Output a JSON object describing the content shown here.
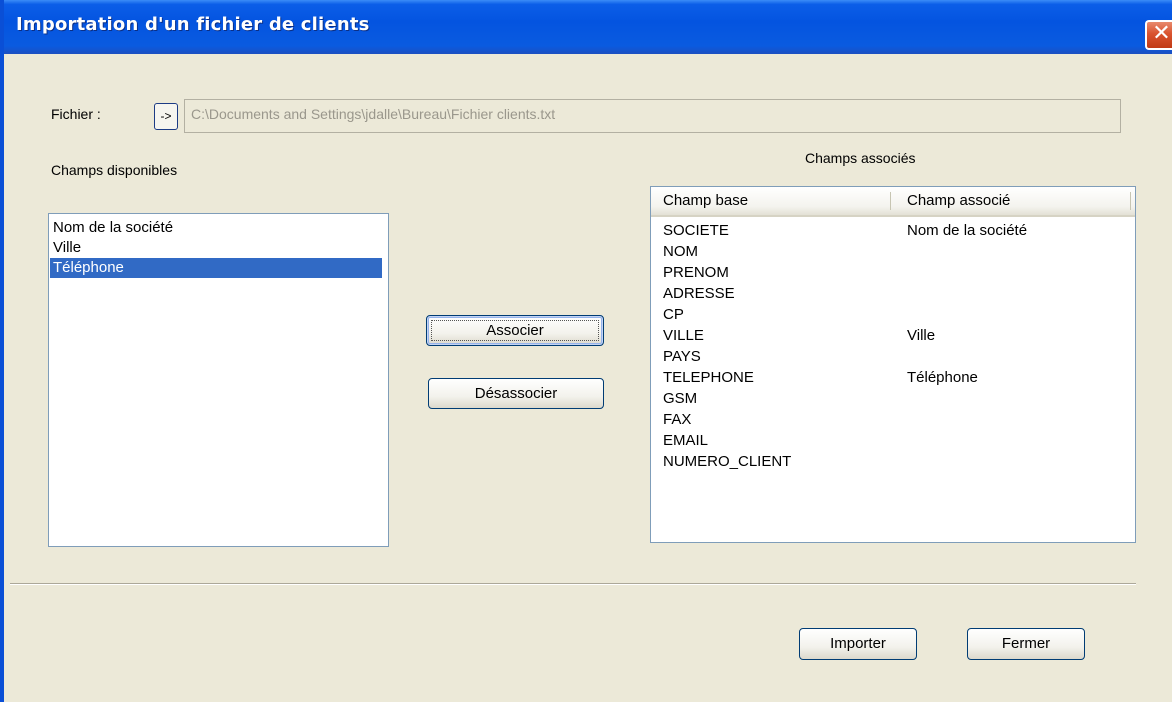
{
  "window": {
    "title": "Importation d'un fichier de clients",
    "close_glyph": "✕"
  },
  "file": {
    "label": "Fichier :",
    "browse_label": "->",
    "path": "C:\\Documents and Settings\\jdalle\\Bureau\\Fichier clients.txt"
  },
  "available": {
    "label": "Champs disponibles",
    "items": [
      "Nom de la société",
      "Ville",
      "Téléphone"
    ],
    "selected_index": 2
  },
  "actions": {
    "associate_label": "Associer",
    "dissociate_label": "Désassocier"
  },
  "associated": {
    "label": "Champs associés",
    "columns": [
      "Champ base",
      "Champ associé"
    ],
    "rows": [
      [
        "SOCIETE",
        "Nom de la société"
      ],
      [
        "NOM",
        ""
      ],
      [
        "PRENOM",
        ""
      ],
      [
        "ADRESSE",
        ""
      ],
      [
        "CP",
        ""
      ],
      [
        "VILLE",
        "Ville"
      ],
      [
        "PAYS",
        ""
      ],
      [
        "TELEPHONE",
        "Téléphone"
      ],
      [
        "GSM",
        ""
      ],
      [
        "FAX",
        ""
      ],
      [
        "EMAIL",
        ""
      ],
      [
        "NUMERO_CLIENT",
        ""
      ]
    ]
  },
  "footer": {
    "import_label": "Importer",
    "close_label": "Fermer"
  }
}
